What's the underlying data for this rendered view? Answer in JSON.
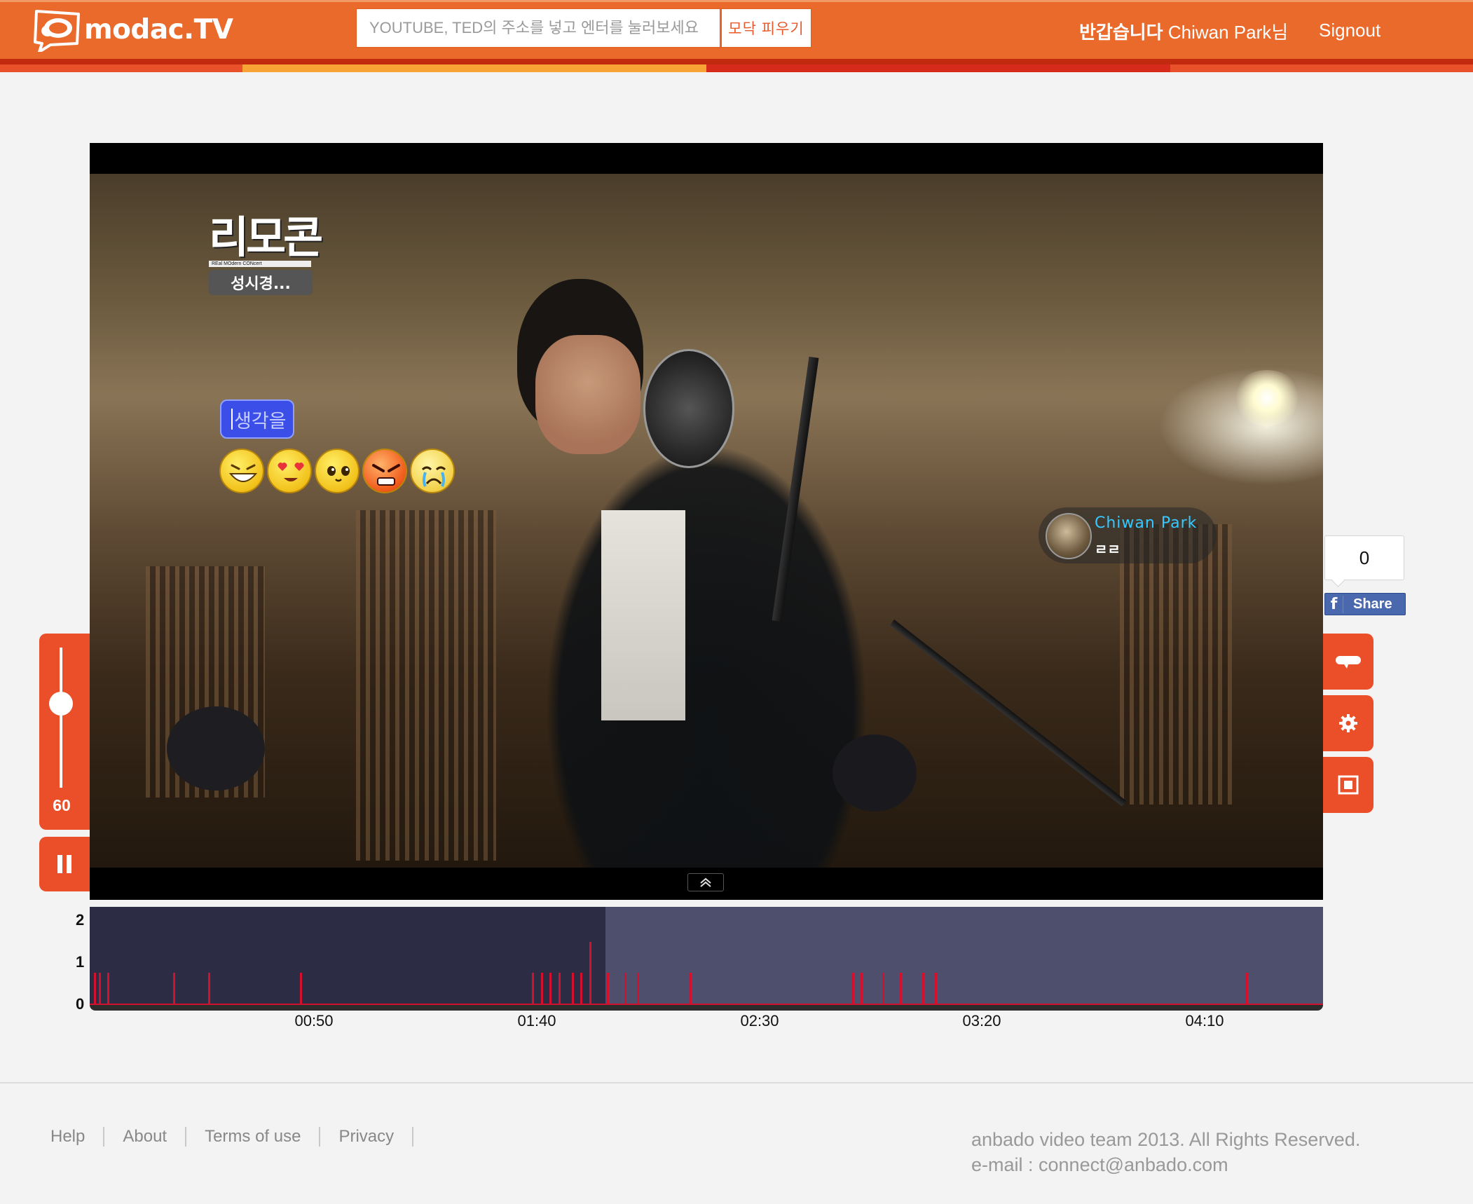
{
  "header": {
    "logo_text": "modac.TV",
    "search_placeholder": "YOUTUBE, TED의 주소를 넣고 엔터를 눌러보세요",
    "search_button": "모닥 피우기",
    "greeting_bold": "반갑습니다",
    "greeting_name": " Chiwan Park님",
    "signout": "Signout",
    "brand_color": "#ea6a2c"
  },
  "video": {
    "show_logo": "리모콘",
    "show_logo_sub": "REal MOdern CONcert",
    "show_tag": "성시경...",
    "emotion_input_value": "생각을",
    "emojis": [
      "laughing-emoji",
      "heart-eyes-emoji",
      "cute-emoji",
      "angry-emoji",
      "crying-emoji"
    ],
    "comment": {
      "user": "Chiwan Park",
      "text": "ㄹㄹ"
    }
  },
  "controls": {
    "volume": "60",
    "volume_level": 0.6,
    "pause_icon": "pause-icon"
  },
  "share": {
    "count": "0",
    "label": "Share",
    "network_icon": "facebook-icon"
  },
  "side_buttons": [
    "comment-icon",
    "gear-icon",
    "fullscreen-icon"
  ],
  "timeline": {
    "y_labels": [
      "2",
      "1",
      "0"
    ],
    "time_labels": [
      "00:50",
      "01:40",
      "02:30",
      "03:20",
      "04:10"
    ]
  },
  "chart_data": {
    "type": "bar",
    "ylim": [
      0,
      2
    ],
    "xlabel": "",
    "ylabel": "",
    "tick_labels": [
      "00:50",
      "01:40",
      "02:30",
      "03:20",
      "04:10"
    ],
    "x_seconds": [
      1,
      2,
      4,
      19,
      27,
      48,
      101,
      103,
      105,
      107,
      110,
      112,
      114,
      118,
      122,
      125,
      137,
      174,
      176,
      181,
      185,
      190,
      193,
      264
    ],
    "values": [
      1,
      1,
      1,
      1,
      1,
      1,
      1,
      1,
      1,
      1,
      1,
      1,
      2,
      1,
      1,
      1,
      1,
      1,
      1,
      1,
      1,
      1,
      1,
      1
    ],
    "progress_seconds": 118
  },
  "footer": {
    "links": [
      "Help",
      "About",
      "Terms of use",
      "Privacy"
    ],
    "copyright": "anbado video team 2013. All Rights Reserved.",
    "email": "e-mail : connect@anbado.com"
  }
}
